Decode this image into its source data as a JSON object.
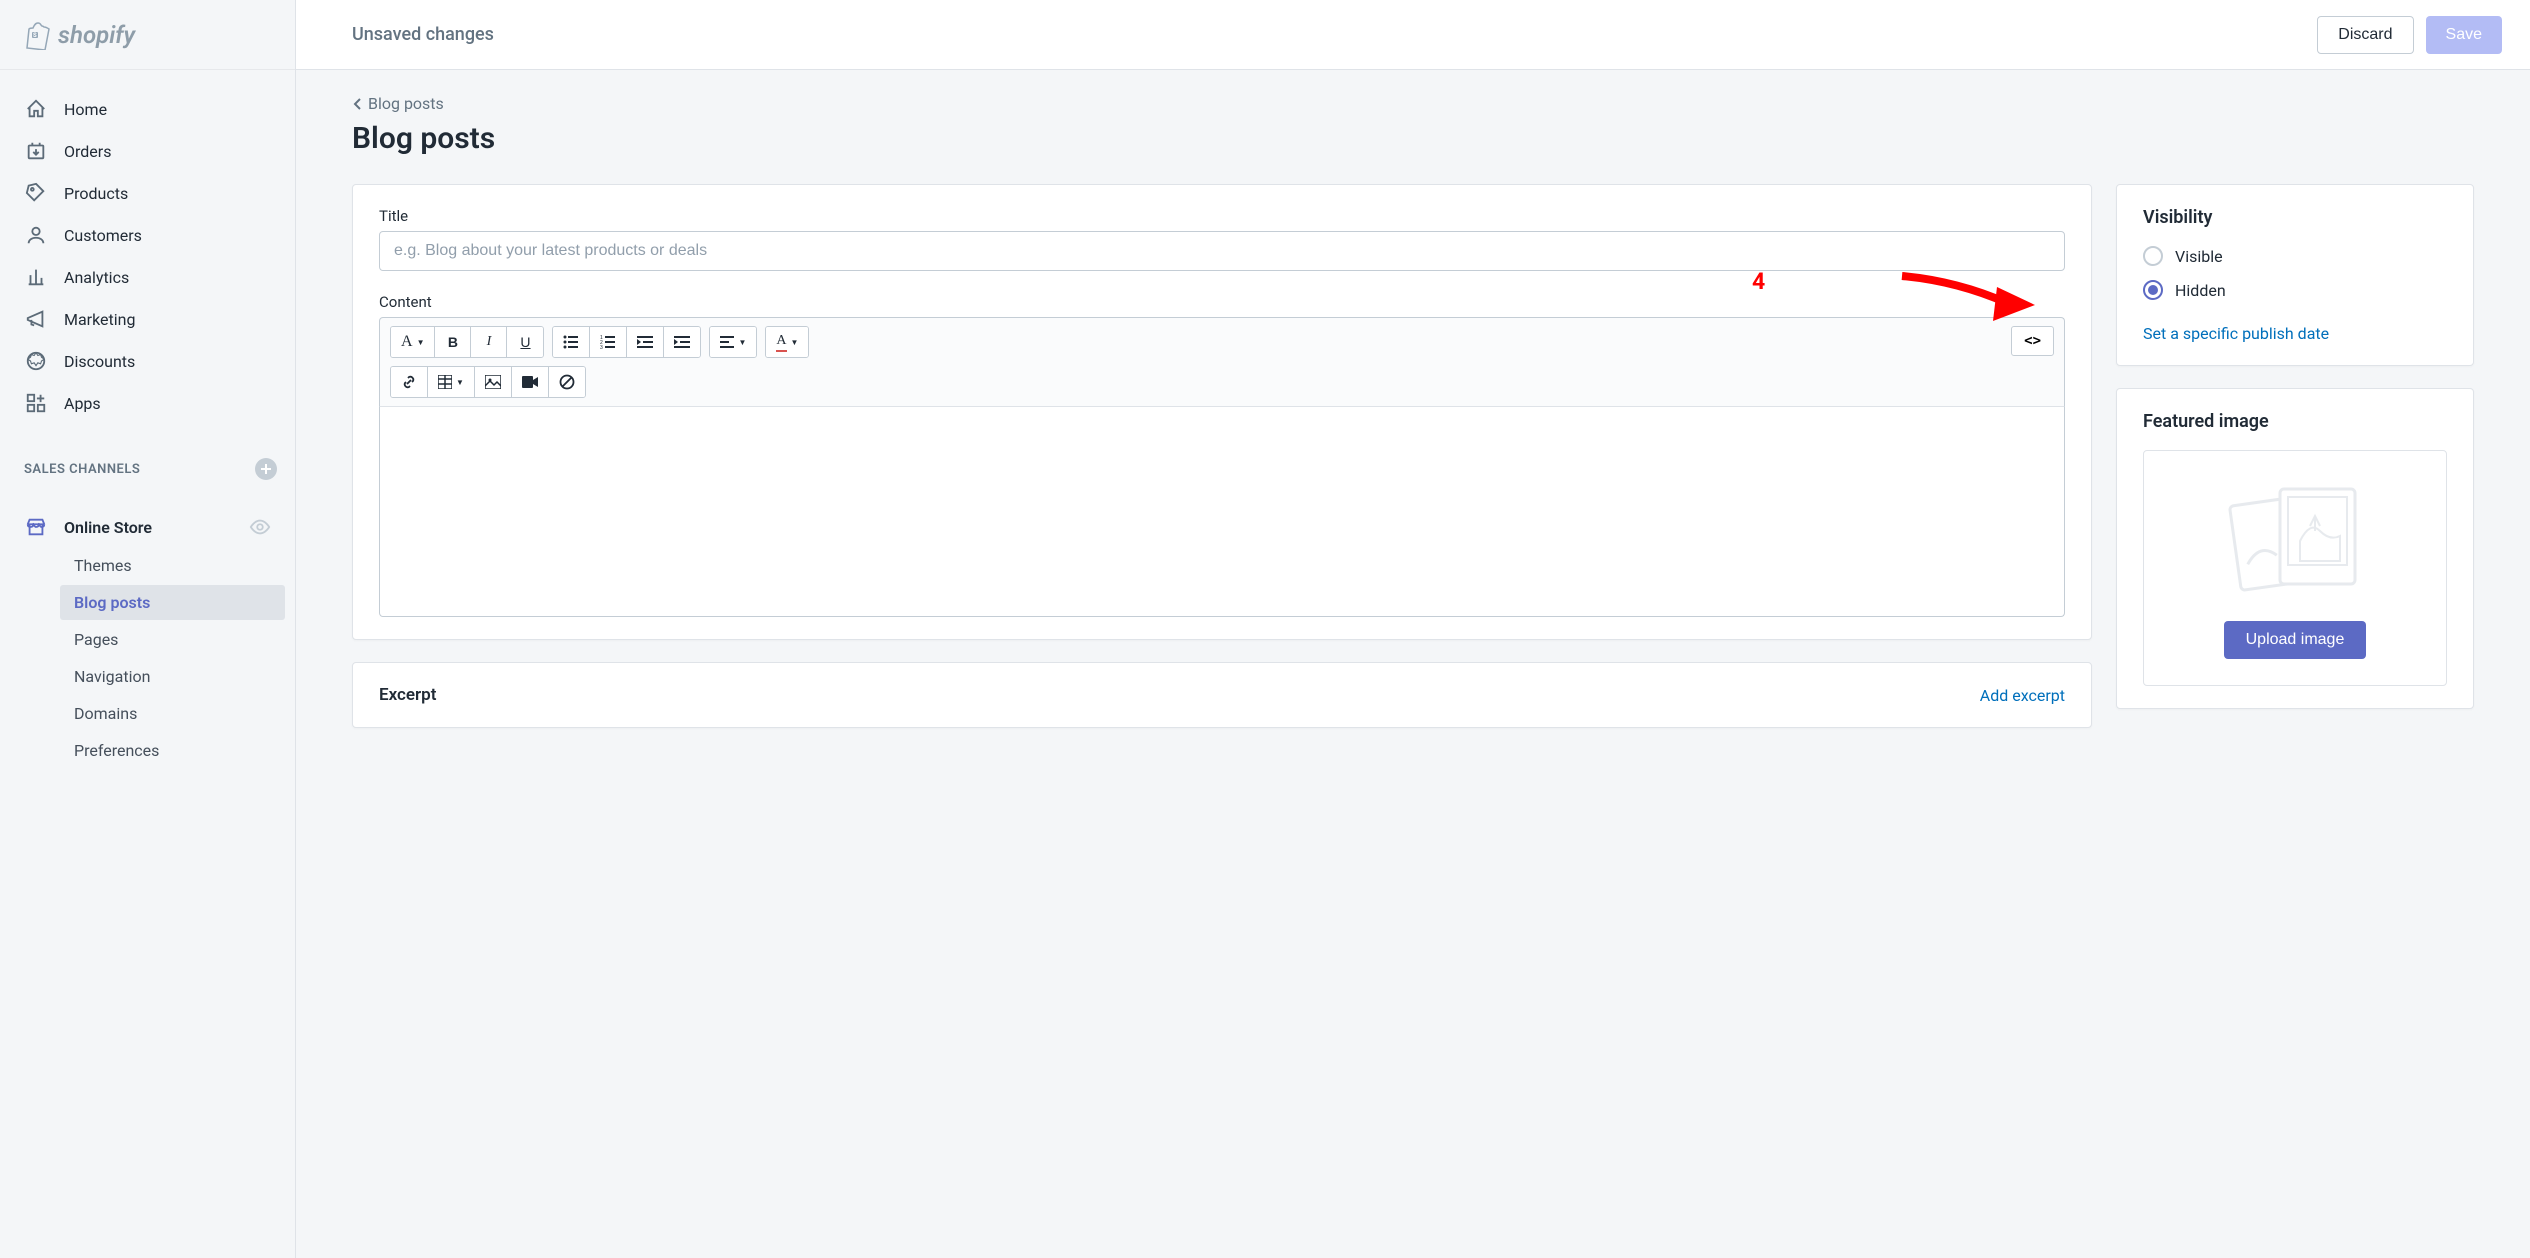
{
  "header": {
    "brand": "shopify",
    "unsaved_label": "Unsaved changes",
    "discard_label": "Discard",
    "save_label": "Save"
  },
  "nav": {
    "items": [
      {
        "label": "Home"
      },
      {
        "label": "Orders"
      },
      {
        "label": "Products"
      },
      {
        "label": "Customers"
      },
      {
        "label": "Analytics"
      },
      {
        "label": "Marketing"
      },
      {
        "label": "Discounts"
      },
      {
        "label": "Apps"
      }
    ],
    "sales_channels_label": "SALES CHANNELS",
    "online_store_label": "Online Store",
    "sub_items": [
      {
        "label": "Themes"
      },
      {
        "label": "Blog posts",
        "active": true
      },
      {
        "label": "Pages"
      },
      {
        "label": "Navigation"
      },
      {
        "label": "Domains"
      },
      {
        "label": "Preferences"
      }
    ]
  },
  "breadcrumb": {
    "label": "Blog posts"
  },
  "page_title": "Blog posts",
  "editor": {
    "title_label": "Title",
    "title_placeholder": "e.g. Blog about your latest products or deals",
    "content_label": "Content",
    "code_btn": "<>"
  },
  "excerpt": {
    "title": "Excerpt",
    "add_link": "Add excerpt"
  },
  "visibility": {
    "title": "Visibility",
    "visible_label": "Visible",
    "hidden_label": "Hidden",
    "selected": "hidden",
    "publish_link": "Set a specific publish date"
  },
  "featured_image": {
    "title": "Featured image",
    "upload_label": "Upload image"
  },
  "annotation": {
    "number": "4"
  }
}
